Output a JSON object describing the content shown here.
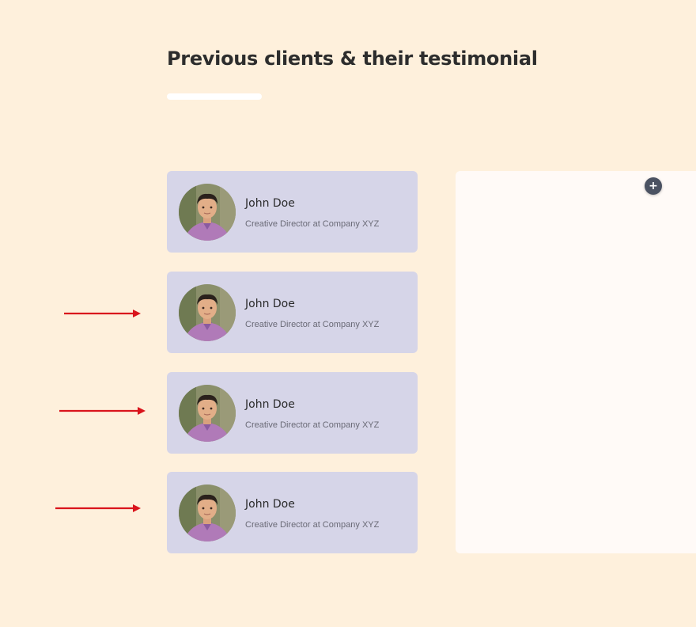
{
  "section": {
    "title": "Previous clients & their testimonial"
  },
  "testimonials": [
    {
      "name": "John Doe",
      "role": "Creative Director at Company XYZ"
    },
    {
      "name": "John Doe",
      "role": "Creative Director at Company XYZ"
    },
    {
      "name": "John Doe",
      "role": "Creative Director at Company XYZ"
    },
    {
      "name": "John Doe",
      "role": "Creative Director at Company XYZ"
    }
  ],
  "detail_panel": {
    "add_label": "+"
  },
  "colors": {
    "page_background": "#fef0dc",
    "card_background": "#d6d5e8",
    "panel_background": "#fffaf7",
    "add_button": "#4b5262",
    "annotation_arrow": "#d9141c"
  },
  "icons": {
    "add": "plus-icon",
    "annotation": "arrow-right-icon"
  }
}
